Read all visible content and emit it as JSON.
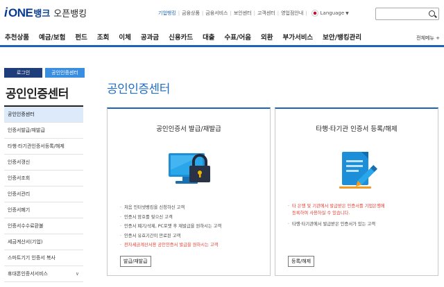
{
  "logo": {
    "i": "i",
    "one": "ONE",
    "bank": "뱅크",
    "open": "오픈뱅킹"
  },
  "topnav": {
    "items": [
      "기업뱅킹",
      "금융상품",
      "금융서비스",
      "보안센터",
      "고객센터",
      "영업점안내"
    ],
    "language": "Language"
  },
  "search": {
    "placeholder": ""
  },
  "gnb": {
    "menus": [
      "추천상품",
      "예금/보험",
      "펀드",
      "조회",
      "이체",
      "공과금",
      "신용카드",
      "대출",
      "수표/어음",
      "외환",
      "부가서비스",
      "보안/뱅킹관리"
    ],
    "all_menu": "전체메뉴 +"
  },
  "sidebar": {
    "login": "로그인",
    "cert": "공인인증센터",
    "title": "공인인증센터",
    "items": [
      "공인인증센터",
      "인증서발급/재발급",
      "타행·타기관인증서등록/해제",
      "인증서갱신",
      "인증서조회",
      "인증서관리",
      "인증서폐기",
      "인증서수수료환불",
      "세금계산서(기업)",
      "스마트기기 인증서 복사",
      "휴대폰인증서서비스"
    ]
  },
  "main": {
    "title": "공인인증센터",
    "card_left": {
      "title": "공인인증서 발급/재발급",
      "bullets": [
        "처음 인터넷뱅킹을 신청하신 고객",
        "인증서 암호를 잊으신 고객",
        "인증서 폐기/삭제, PC포맷 후 재발급을 원하시는 고객",
        "인증서 유효기간이 만료된 고객",
        "전자세금계산서용 공인인증서 발급을 원하시는 고객"
      ],
      "button": "발급/재발급"
    },
    "card_right": {
      "title": "타행·타기관 인증서 등록/해제",
      "bullet_red_1": "타 은행 및 기관에서 발급받은 인증서를 기업은행에",
      "bullet_red_2": "등록하여 사용하실 수 있습니다.",
      "bullet_2": "타행·타기관에서 발급받은 인증서가 있는 고객",
      "button": "등록/해제"
    }
  },
  "colors": {
    "accent": "#1b64b4",
    "navy": "#1f3d7a",
    "red": "#e03b2f",
    "active_bg": "#ddeafa"
  },
  "icons": [
    "search-icon",
    "flag-icon",
    "monitor-lock-icon",
    "document-pen-icon",
    "chevron-down-icon"
  ]
}
